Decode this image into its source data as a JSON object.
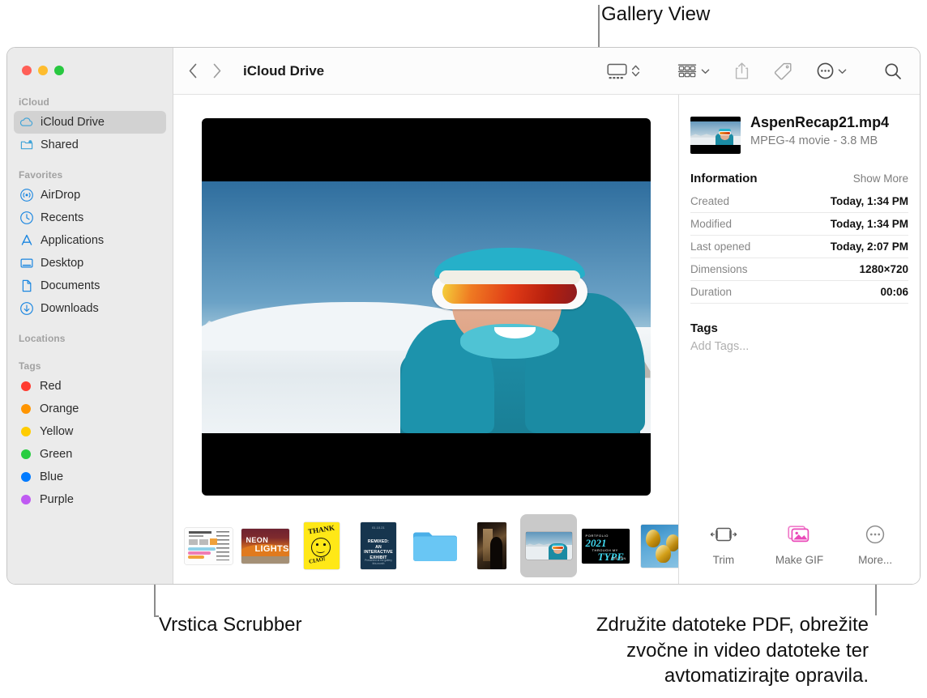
{
  "callouts": {
    "gallery_view": "Gallery View",
    "scrubber": "Vrstica Scrubber",
    "quick_actions": "Združite datoteke PDF, obrežite\nzvočne in video datoteke ter\navtomatizirajte opravila."
  },
  "window": {
    "traffic_lights": [
      "close",
      "minimize",
      "zoom"
    ]
  },
  "sidebar": {
    "sections": [
      {
        "title": "iCloud",
        "items": [
          {
            "label": "iCloud Drive",
            "icon": "cloud-icon",
            "selected": true
          },
          {
            "label": "Shared",
            "icon": "shared-folder-icon",
            "selected": false
          }
        ]
      },
      {
        "title": "Favorites",
        "items": [
          {
            "label": "AirDrop",
            "icon": "airdrop-icon",
            "selected": false
          },
          {
            "label": "Recents",
            "icon": "clock-icon",
            "selected": false
          },
          {
            "label": "Applications",
            "icon": "applications-icon",
            "selected": false
          },
          {
            "label": "Desktop",
            "icon": "desktop-icon",
            "selected": false
          },
          {
            "label": "Documents",
            "icon": "document-icon",
            "selected": false
          },
          {
            "label": "Downloads",
            "icon": "download-icon",
            "selected": false
          }
        ]
      },
      {
        "title": "Locations",
        "items": []
      },
      {
        "title": "Tags",
        "items": [
          {
            "label": "Red",
            "color": "#ff3b30"
          },
          {
            "label": "Orange",
            "color": "#ff9500"
          },
          {
            "label": "Yellow",
            "color": "#ffcc00"
          },
          {
            "label": "Green",
            "color": "#28cd41"
          },
          {
            "label": "Blue",
            "color": "#007aff"
          },
          {
            "label": "Purple",
            "color": "#bf5af2"
          }
        ]
      }
    ]
  },
  "toolbar": {
    "back_icon": "chevron-left-icon",
    "forward_icon": "chevron-right-icon",
    "title": "iCloud Drive",
    "view_icon": "gallery-view-icon",
    "view_stepper_icon": "up-down-chevron-icon",
    "group_icon": "group-by-icon",
    "share_icon": "share-icon",
    "tag_icon": "tag-icon",
    "more_icon": "more-circle-icon",
    "search_icon": "search-icon"
  },
  "preview": {
    "media_type": "video",
    "description": "Smiling skier in teal jacket with white goggles on a snowy mountain"
  },
  "scrubber": {
    "items": [
      {
        "name": "chart-document",
        "selected": false
      },
      {
        "name": "neon-lights-poster",
        "selected": false,
        "line1": "NEON",
        "line2": "LIGHTS"
      },
      {
        "name": "thank-you-poster",
        "selected": false,
        "line1": "THANK",
        "line2": "CIAO!"
      },
      {
        "name": "exhibit-poster",
        "selected": false,
        "date": "01.10.21",
        "title": "REMIXED:\nAN INTERACTIVE\nEXHIBIT",
        "footer": "Presented at the gallery this month"
      },
      {
        "name": "blue-folder",
        "selected": false
      },
      {
        "name": "silhouette-photo",
        "selected": false
      },
      {
        "name": "aspen-recap-video",
        "selected": true
      },
      {
        "name": "type-portfolio-poster",
        "selected": false,
        "p1": "PORTFOLIO",
        "p2": "2021",
        "p3": "THROUGH MY",
        "p4": "TYPE",
        "p5": "FED PEN"
      },
      {
        "name": "gold-balloons-photo",
        "selected": false
      }
    ]
  },
  "info_panel": {
    "file_name": "AspenRecap21.mp4",
    "file_meta": "MPEG-4 movie - 3.8 MB",
    "section_title": "Information",
    "show_more": "Show More",
    "rows": [
      {
        "key": "Created",
        "value": "Today, 1:34 PM"
      },
      {
        "key": "Modified",
        "value": "Today, 1:34 PM"
      },
      {
        "key": "Last opened",
        "value": "Today, 2:07 PM"
      },
      {
        "key": "Dimensions",
        "value": "1280×720"
      },
      {
        "key": "Duration",
        "value": "00:06"
      }
    ],
    "tags_title": "Tags",
    "tags_placeholder": "Add Tags..."
  },
  "quick_actions": [
    {
      "label": "Trim",
      "icon": "trim-icon"
    },
    {
      "label": "Make GIF",
      "icon": "make-gif-icon"
    },
    {
      "label": "More...",
      "icon": "more-circle-icon"
    }
  ],
  "colors": {
    "accent_blue": "#007aff",
    "sidebar_bg": "#ebebeb",
    "selection_gray": "#d2d2d2",
    "gif_pink": "#f45fc0"
  }
}
